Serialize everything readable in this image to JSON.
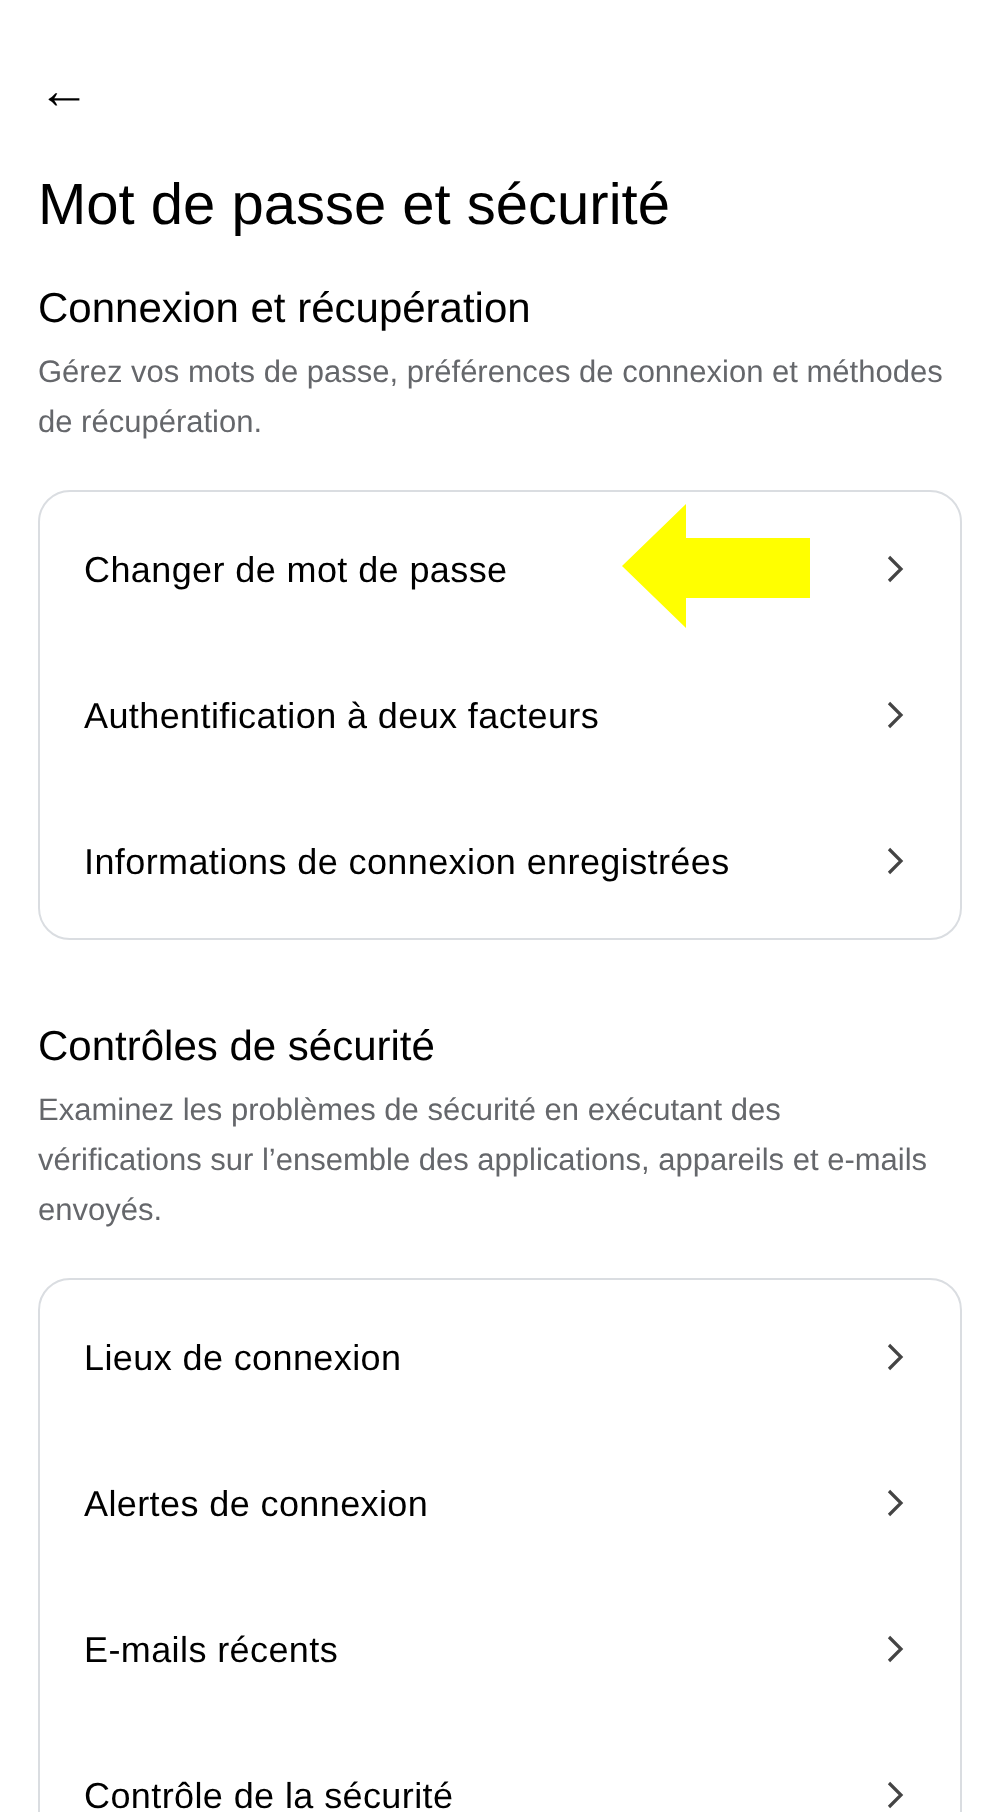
{
  "back_button": {
    "icon": "←"
  },
  "title": "Mot de passe et sécurité",
  "sections": [
    {
      "heading": "Connexion et récupération",
      "description": "Gérez vos mots de passe, préférences de connexion et méthodes de récupération.",
      "items": [
        {
          "label": "Changer de mot de passe",
          "highlighted": true
        },
        {
          "label": "Authentification à deux facteurs",
          "highlighted": false
        },
        {
          "label": "Informations de connexion enregistrées",
          "highlighted": false
        }
      ]
    },
    {
      "heading": "Contrôles de sécurité",
      "description": "Examinez les problèmes de sécurité en exécutant des vérifications sur l’ensemble des applications, appareils et e-mails envoyés.",
      "items": [
        {
          "label": "Lieux de connexion",
          "highlighted": false
        },
        {
          "label": "Alertes de connexion",
          "highlighted": false
        },
        {
          "label": "E-mails récents",
          "highlighted": false
        },
        {
          "label": "Contrôle de la sécurité",
          "highlighted": false
        }
      ]
    }
  ]
}
